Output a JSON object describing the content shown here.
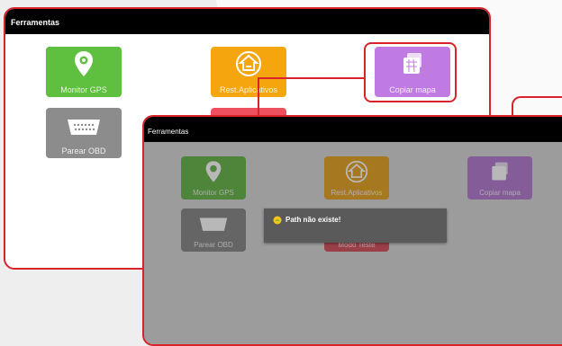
{
  "back_window": {
    "title": "Ferramentas",
    "tiles": [
      {
        "label": "Monitor GPS",
        "icon": "location-pin-icon",
        "color": "#5fbf3e"
      },
      {
        "label": "Rest.Aplicativos",
        "icon": "home-arrow-icon",
        "color": "#f5a50d"
      },
      {
        "label": "Copiar mapa",
        "icon": "map-copy-icon",
        "color": "#c07be3"
      },
      {
        "label": "Parear OBD",
        "icon": "obd-connector-icon",
        "color": "#8c8c8c"
      },
      {
        "label": "",
        "icon": "red-tile-partial",
        "color": "#ef5060"
      }
    ]
  },
  "front_window": {
    "title": "Ferramentas",
    "tiles": [
      {
        "label": "Monitor GPS",
        "icon": "location-pin-icon"
      },
      {
        "label": "Rest.Aplicativos",
        "icon": "home-arrow-icon"
      },
      {
        "label": "Copiar mapa",
        "icon": "map-copy-icon"
      },
      {
        "label": "Parear OBD",
        "icon": "obd-connector-icon"
      },
      {
        "label": "Modo Teste",
        "icon": "test-icon"
      }
    ]
  },
  "toast": {
    "message": "Path não existe!",
    "icon": "android-icon"
  },
  "colors": {
    "accent": "#d8232a",
    "titlebar": "#000000"
  }
}
